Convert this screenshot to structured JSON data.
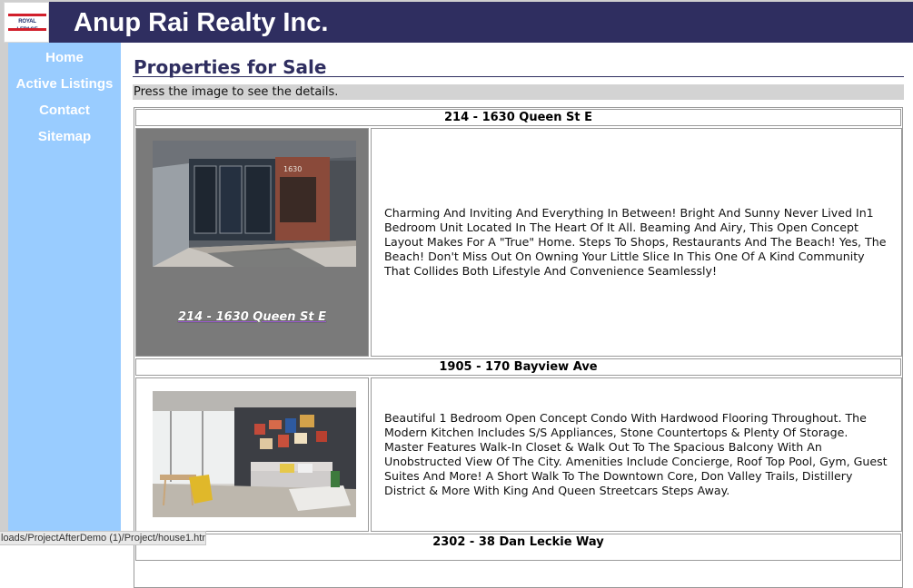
{
  "brand": {
    "logo_text": "ROYAL LEPAGE",
    "site_title": "Anup Rai Realty Inc."
  },
  "colors": {
    "header_bg": "#2f2e60",
    "sidebar_bg": "#99ccff",
    "hint_bg": "#d3d3d3",
    "logo_red": "#d11f2b"
  },
  "nav": [
    {
      "label": "Home"
    },
    {
      "label": "Active Listings"
    },
    {
      "label": "Contact"
    },
    {
      "label": "Sitemap"
    }
  ],
  "main": {
    "title": "Properties for Sale",
    "hint": "Press the image to see the details."
  },
  "listings": [
    {
      "title": "214 - 1630 Queen St E",
      "caption": "214 - 1630 Queen St E",
      "photo_icon": "condo-lobby-photo",
      "description": "Charming And Inviting And Everything In Between! Bright And Sunny Never Lived In1 Bedroom Unit Located In The Heart Of It All. Beaming And Airy, This Open Concept Layout Makes For A \"True\" Home. Steps To Shops, Restaurants And The Beach! Yes, The Beach! Don't Miss Out On Owning Your Little Slice In This One Of A Kind Community That Collides Both Lifestyle And Convenience Seamlessly!"
    },
    {
      "title": "1905 - 170 Bayview Ave",
      "photo_icon": "living-room-photo",
      "description": "Beautiful 1 Bedroom Open Concept Condo With Hardwood Flooring Throughout. The Modern Kitchen Includes S/S Appliances, Stone Countertops & Plenty Of Storage. Master Features Walk-In Closet & Walk Out To The Spacious Balcony With An Unobstructed View Of The City. Amenities Include Concierge, Roof Top Pool, Gym, Guest Suites And More! A Short Walk To The Downtown Core, Don Valley Trails, Distillery District & More With King And Queen Streetcars Steps Away."
    },
    {
      "title": "2302 - 38 Dan Leckie Way"
    }
  ],
  "status": {
    "url": "loads/ProjectAfterDemo (1)/Project/house1.html"
  }
}
